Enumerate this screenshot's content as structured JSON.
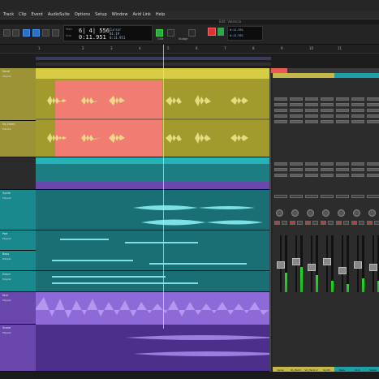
{
  "menubar": {
    "items": [
      "Track",
      "Clip",
      "Event",
      "AudioSuite",
      "Options",
      "Setup",
      "Window",
      "Avid Link",
      "Help"
    ]
  },
  "window": {
    "title": "Edit: Valencia"
  },
  "transport": {
    "counter_main_label": "Main",
    "counter_sub_label": "Sub",
    "counter_main": "6| 4| 556",
    "counter_sub": "0:11.951",
    "counter_main2": "01:19",
    "counter_sub2": "0:11.951",
    "cursor_label": "Cursor",
    "grid_label": "Grid",
    "nudge_label": "Nudge",
    "right_display_1": "0:11.951",
    "right_display_2": "0:11.951"
  },
  "ruler": {
    "ticks": [
      "1",
      "2",
      "3",
      "4",
      "5",
      "6",
      "7",
      "8",
      "9",
      "10",
      "11"
    ]
  },
  "tracks": [
    {
      "name": "Vocal",
      "sub": "Playlist",
      "color": "#b2a63a"
    },
    {
      "name": "Vo_Harm",
      "sub": "Playlist",
      "color": "#b2a63a"
    },
    {
      "name": "Synth",
      "sub": "Playlist",
      "color": "#1ea0a6"
    },
    {
      "name": "Pad",
      "sub": "Playlist",
      "color": "#1ea0a6"
    },
    {
      "name": "Bass",
      "sub": "Playlist",
      "color": "#1ea0a6"
    },
    {
      "name": "Drum",
      "sub": "Playlist",
      "color": "#1ea0a6"
    },
    {
      "name": "Kick",
      "sub": "Playlist",
      "color": "#7b55c7"
    },
    {
      "name": "Snare",
      "sub": "Playlist",
      "color": "#7b55c7"
    }
  ],
  "mixer": {
    "strips": [
      {
        "name": "Vocal",
        "color": "#c5b84a",
        "meter": 0.35,
        "fader": 0.55
      },
      {
        "name": "Vo_Harm",
        "color": "#c5b84a",
        "meter": 0.45,
        "fader": 0.6
      },
      {
        "name": "Vo_Harm 2",
        "color": "#c5b84a",
        "meter": 0.3,
        "fader": 0.5
      },
      {
        "name": "Synth",
        "color": "#c5b84a",
        "meter": 0.2,
        "fader": 0.6
      },
      {
        "name": "Pads",
        "color": "#1ea0a6",
        "meter": 0.15,
        "fader": 0.45
      },
      {
        "name": "Kick",
        "color": "#1ea0a6",
        "meter": 0.25,
        "fader": 0.55
      },
      {
        "name": "Snare",
        "color": "#1ea0a6",
        "meter": 0.2,
        "fader": 0.5
      }
    ],
    "bottom_labels": [
      "Pads",
      "Stringd 1.L"
    ]
  }
}
